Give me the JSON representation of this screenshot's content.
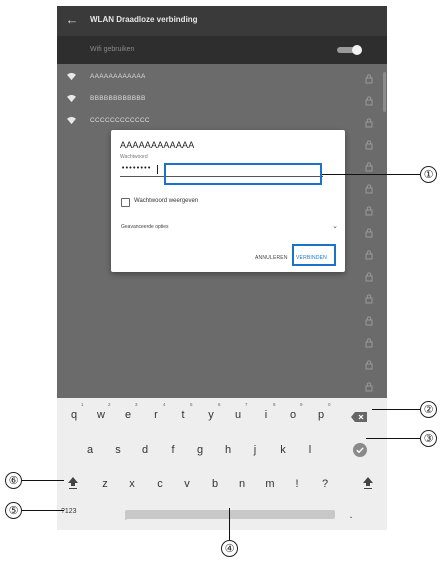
{
  "appbar": {
    "title": "WLAN Draadloze verbinding",
    "back_icon": "arrow-left-icon"
  },
  "wifi_toggle": {
    "label": "Wifi gebruiken",
    "state": "on"
  },
  "networks": [
    {
      "name": "AAAAAAAAAAAA"
    },
    {
      "name": "BBBBBBBBBBBB"
    },
    {
      "name": "CCCCCCCCCCCC"
    }
  ],
  "dialog": {
    "ssid": "AAAAAAAAAAAA",
    "password_label": "Wachtwoord",
    "password_value": "••••••••",
    "show_password_label": "Wachtwoord weergeven",
    "advanced_label": "Geavanceerde opties",
    "cancel_label": "ANNULEREN",
    "connect_label": "VERBINDEN"
  },
  "keyboard": {
    "row1": [
      "q",
      "w",
      "e",
      "r",
      "t",
      "y",
      "u",
      "i",
      "o",
      "p"
    ],
    "row1_hints": [
      "1",
      "2",
      "3",
      "4",
      "5",
      "6",
      "7",
      "8",
      "9",
      "0"
    ],
    "row2": [
      "a",
      "s",
      "d",
      "f",
      "g",
      "h",
      "j",
      "k",
      "l"
    ],
    "row3": [
      "z",
      "x",
      "c",
      "v",
      "b",
      "n",
      "m",
      "!",
      "?"
    ],
    "row4_left": "?123",
    "row4_comma": ",",
    "row4_period": "."
  },
  "callouts": [
    "①",
    "②",
    "③",
    "④",
    "⑤",
    "⑥"
  ],
  "colors": {
    "highlight": "#1a73c8",
    "appbar": "#3a3a3a",
    "overlay": "#6b6b6b",
    "keyboard": "#eeeeee"
  }
}
